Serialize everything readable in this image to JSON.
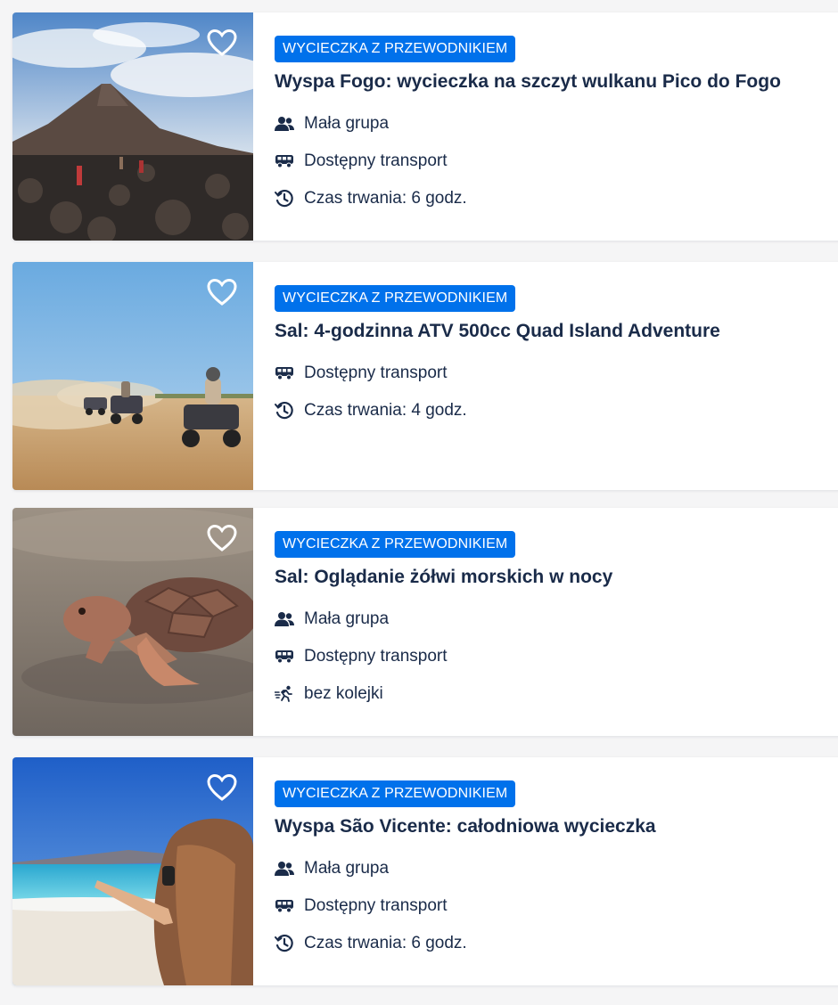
{
  "colors": {
    "badge": "#0071eb",
    "text": "#1a2b49",
    "card": "#ffffff"
  },
  "cards": [
    {
      "badge": "WYCIECZKA Z PRZEWODNIKIEM",
      "title": "Wyspa Fogo: wycieczka na szczyt wulkanu Pico do Fogo",
      "image": "volcano-hike-photo",
      "features": [
        {
          "icon": "group-icon",
          "label": "Mała grupa"
        },
        {
          "icon": "bus-icon",
          "label": "Dostępny transport"
        },
        {
          "icon": "clock-icon",
          "label": "Czas trwania: 6 godz."
        }
      ]
    },
    {
      "badge": "WYCIECZKA Z PRZEWODNIKIEM",
      "title": "Sal: 4-godzinna ATV 500cc Quad Island Adventure",
      "image": "atv-desert-photo",
      "features": [
        {
          "icon": "bus-icon",
          "label": "Dostępny transport"
        },
        {
          "icon": "clock-icon",
          "label": "Czas trwania: 4 godz."
        }
      ]
    },
    {
      "badge": "WYCIECZKA Z PRZEWODNIKIEM",
      "title": "Sal: Oglądanie żółwi morskich w nocy",
      "image": "sea-turtle-photo",
      "features": [
        {
          "icon": "group-icon",
          "label": "Mała grupa"
        },
        {
          "icon": "bus-icon",
          "label": "Dostępny transport"
        },
        {
          "icon": "skip-line-icon",
          "label": "bez kolejki"
        }
      ]
    },
    {
      "badge": "WYCIECZKA Z PRZEWODNIKIEM",
      "title": "Wyspa São Vicente: całodniowa wycieczka",
      "image": "beach-pointing-photo",
      "features": [
        {
          "icon": "group-icon",
          "label": "Mała grupa"
        },
        {
          "icon": "bus-icon",
          "label": "Dostępny transport"
        },
        {
          "icon": "clock-icon",
          "label": "Czas trwania: 6 godz."
        }
      ]
    }
  ]
}
